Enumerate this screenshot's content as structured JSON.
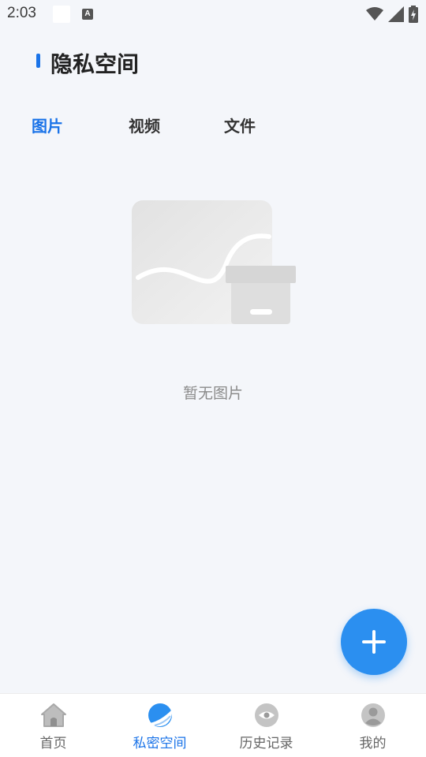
{
  "status_bar": {
    "time": "2:03",
    "notification_badge": "A",
    "icons": [
      "wifi-icon",
      "signal-icon",
      "battery-charging-icon"
    ]
  },
  "header": {
    "title": "隐私空间",
    "accent_color": "#1a73e8"
  },
  "tabs": [
    {
      "label": "图片",
      "active": true
    },
    {
      "label": "视频",
      "active": false
    },
    {
      "label": "文件",
      "active": false
    }
  ],
  "empty_state": {
    "message": "暂无图片",
    "icon": "empty-box-illustration"
  },
  "fab": {
    "icon": "plus-icon",
    "color": "#2b8ff0"
  },
  "bottom_nav": [
    {
      "label": "首页",
      "icon": "home-icon",
      "active": false
    },
    {
      "label": "私密空间",
      "icon": "private-space-icon",
      "active": true
    },
    {
      "label": "历史记录",
      "icon": "eye-icon",
      "active": false
    },
    {
      "label": "我的",
      "icon": "user-icon",
      "active": false
    }
  ],
  "colors": {
    "background": "#f4f6fa",
    "active": "#1a73e8",
    "inactive_text": "#666666"
  }
}
